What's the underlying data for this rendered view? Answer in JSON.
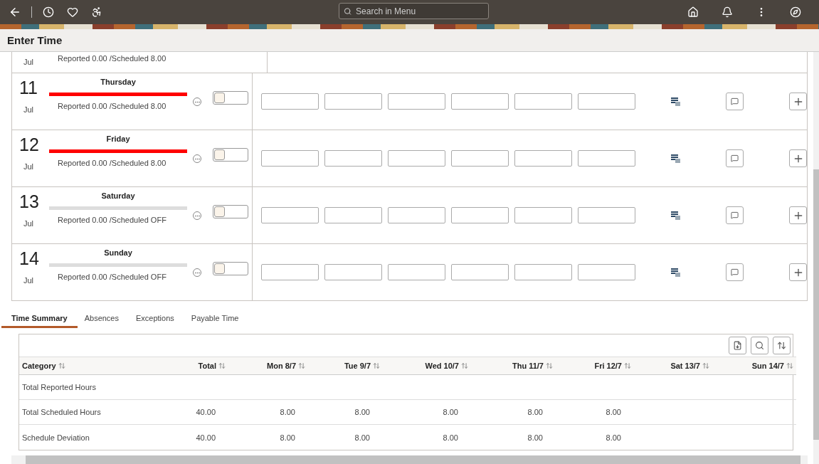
{
  "header": {
    "search": {
      "placeholder": "Search in Menu"
    }
  },
  "page_title": "Enter Time",
  "partial_day": {
    "month": "Jul",
    "status": "Reported 0.00 /Scheduled 8.00"
  },
  "days": [
    {
      "date": "11",
      "month": "Jul",
      "weekday": "Thursday",
      "color": "#ff0000",
      "status": "Reported 0.00 /Scheduled 8.00",
      "on": false
    },
    {
      "date": "12",
      "month": "Jul",
      "weekday": "Friday",
      "color": "#ff0000",
      "status": "Reported 0.00 /Scheduled 8.00",
      "on": false
    },
    {
      "date": "13",
      "month": "Jul",
      "weekday": "Saturday",
      "color": "#dddddd",
      "status": "Reported 0.00 /Scheduled OFF",
      "on": false
    },
    {
      "date": "14",
      "month": "Jul",
      "weekday": "Sunday",
      "color": "#dddddd",
      "status": "Reported 0.00 /Scheduled OFF",
      "on": false
    }
  ],
  "tabs": [
    {
      "label": "Time Summary",
      "selected": true
    },
    {
      "label": "Absences",
      "selected": false
    },
    {
      "label": "Exceptions",
      "selected": false
    },
    {
      "label": "Payable Time",
      "selected": false
    }
  ],
  "table": {
    "columns": [
      "Category",
      "Total",
      "Mon 8/7",
      "Tue 9/7",
      "Wed 10/7",
      "Thu 11/7",
      "Fri 12/7",
      "Sat 13/7",
      "Sun 14/7"
    ],
    "rows": [
      [
        "Total Reported Hours",
        "",
        "",
        "",
        "",
        "",
        "",
        "",
        ""
      ],
      [
        "Total Scheduled Hours",
        "40.00",
        "8.00",
        "8.00",
        "8.00",
        "8.00",
        "8.00",
        "",
        ""
      ],
      [
        "Schedule Deviation",
        "40.00",
        "8.00",
        "8.00",
        "8.00",
        "8.00",
        "8.00",
        "",
        ""
      ]
    ]
  }
}
